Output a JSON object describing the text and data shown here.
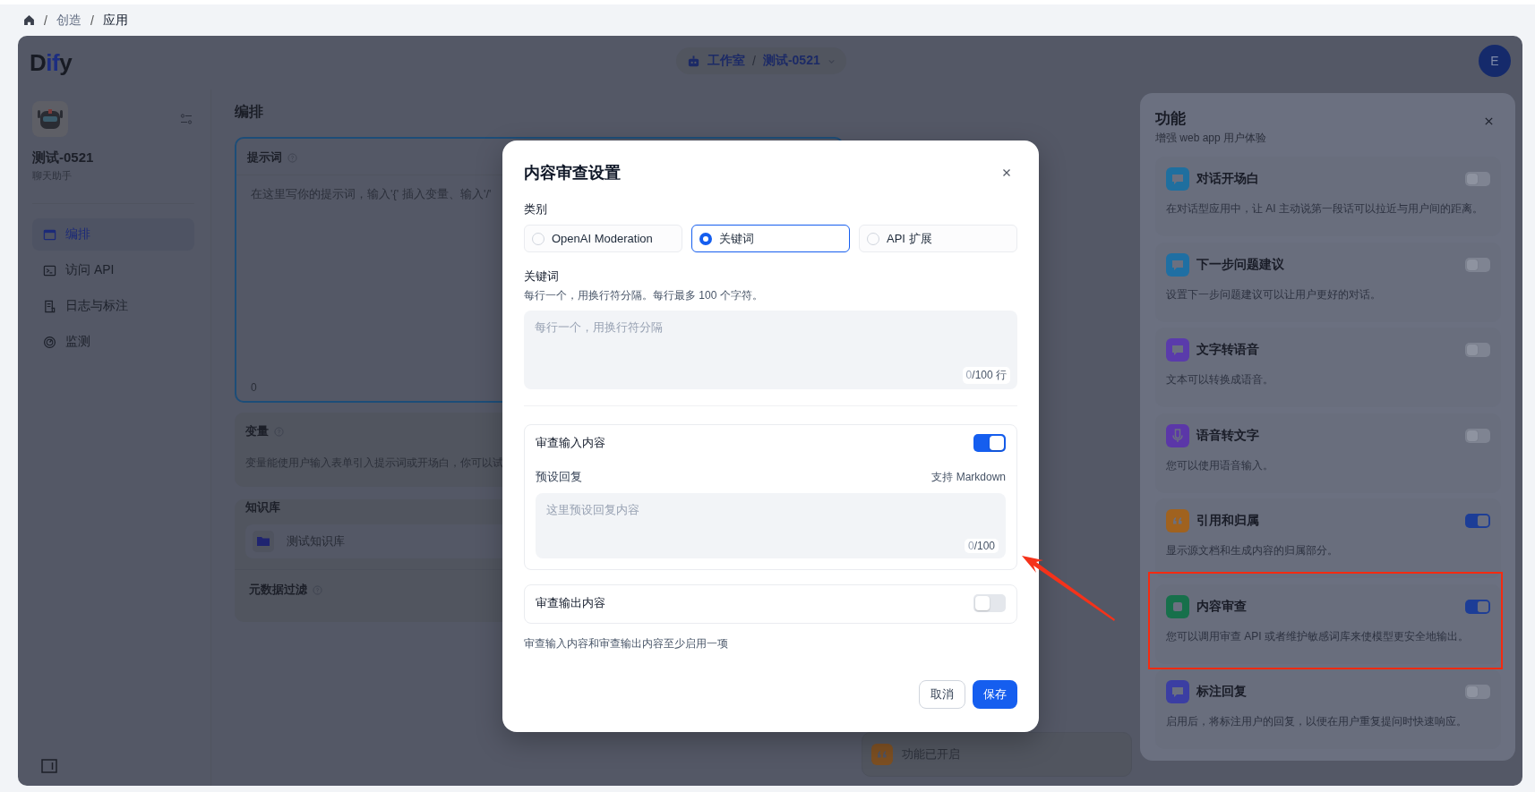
{
  "breadcrumb": {
    "separator": "/",
    "items": [
      {
        "label": "创造",
        "current": false
      },
      {
        "label": "应用",
        "current": true
      }
    ]
  },
  "header": {
    "logo": "Dify",
    "workspace": "工作室",
    "separator": "/",
    "app": "测试-0521",
    "avatar": "E"
  },
  "sidebar": {
    "app_name": "测试-0521",
    "app_type": "聊天助手",
    "nav": [
      {
        "label": "编排",
        "selected": true
      },
      {
        "label": "访问 API",
        "selected": false
      },
      {
        "label": "日志与标注",
        "selected": false
      },
      {
        "label": "监测",
        "selected": false
      }
    ]
  },
  "main": {
    "title": "编排",
    "prompt": {
      "label": "提示词",
      "placeholder": "在这里写你的提示词，输入'{' 插入变量、输入'/'",
      "count": "0"
    },
    "variables": {
      "label": "变量",
      "description": "变量能使用户输入表单引入提示词或开场白，你可以试"
    },
    "knowledge": {
      "label": "知识库",
      "items": [
        "测试知识库"
      ],
      "filter_label": "元数据过滤"
    },
    "features_status": "功能已开启"
  },
  "features": {
    "title": "功能",
    "subtitle": "增强 web app 用户体验",
    "items": [
      {
        "title": "对话开场白",
        "description": "在对话型应用中，让 AI 主动说第一段话可以拉近与用户间的距离。",
        "on": false,
        "color": "#1f6f9f"
      },
      {
        "title": "下一步问题建议",
        "description": "设置下一步问题建议可以让用户更好的对话。",
        "on": false,
        "color": "#1f6fa3"
      },
      {
        "title": "文字转语音",
        "description": "文本可以转换成语音。",
        "on": false,
        "color": "#5a3bab"
      },
      {
        "title": "语音转文字",
        "description": "您可以使用语音输入。",
        "on": false,
        "color": "#5b37a8"
      },
      {
        "title": "引用和归属",
        "description": "显示源文档和生成内容的归属部分。",
        "on": true,
        "color": "#a0621f"
      },
      {
        "title": "内容审查",
        "description": "您可以调用审查 API 或者维护敏感词库来使模型更安全地输出。",
        "on": true,
        "color": "#17704b"
      },
      {
        "title": "标注回复",
        "description": "启用后，将标注用户的回复，以便在用户重复提问时快速响应。",
        "on": false,
        "color": "#3b3ea3"
      }
    ]
  },
  "modal": {
    "title": "内容审查设置",
    "category_label": "类别",
    "categories": [
      {
        "label": "OpenAI Moderation",
        "selected": false
      },
      {
        "label": "关键词",
        "selected": true
      },
      {
        "label": "API 扩展",
        "selected": false
      }
    ],
    "keywords": {
      "label": "关键词",
      "hint": "每行一个，用换行符分隔。每行最多 100 个字符。",
      "placeholder": "每行一个，用换行符分隔",
      "count": "0",
      "limit": "/100 行"
    },
    "input_review": {
      "label": "审查输入内容",
      "on": true,
      "preset_label": "预设回复",
      "markdown_note": "支持 Markdown",
      "placeholder": "这里预设回复内容",
      "count": "0",
      "limit": "/100"
    },
    "output_review": {
      "label": "审查输出内容",
      "on": false
    },
    "note": "审查输入内容和审查输出内容至少启用一项",
    "cancel": "取消",
    "save": "保存"
  }
}
